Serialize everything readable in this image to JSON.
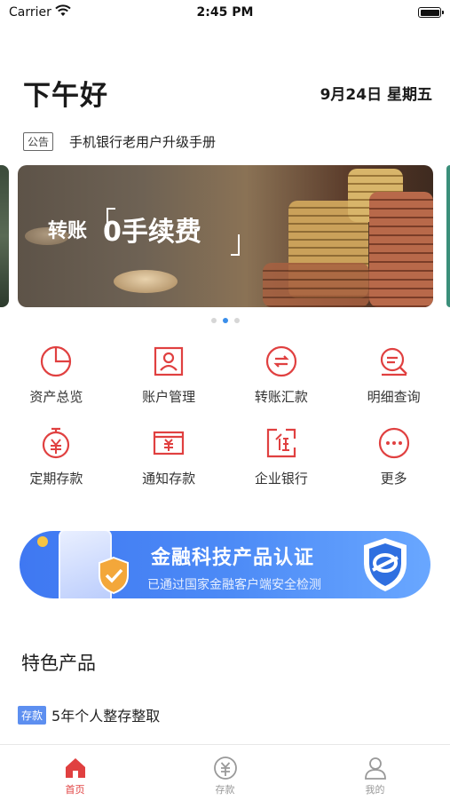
{
  "status_bar": {
    "carrier": "Carrier",
    "time": "2:45 PM"
  },
  "header": {
    "greeting": "下午好",
    "date": "9月24日 星期五"
  },
  "notice": {
    "tag": "公告",
    "text": "手机银行老用户升级手册"
  },
  "banner": {
    "text_prefix": "转账",
    "text_highlight": "0手续费",
    "page_count": 3,
    "active_page": 2
  },
  "quick_actions": [
    {
      "label": "资产总览",
      "icon": "pie-chart-icon"
    },
    {
      "label": "账户管理",
      "icon": "account-icon"
    },
    {
      "label": "转账汇款",
      "icon": "transfer-icon"
    },
    {
      "label": "明细查询",
      "icon": "search-detail-icon"
    },
    {
      "label": "定期存款",
      "icon": "timer-deposit-icon"
    },
    {
      "label": "通知存款",
      "icon": "notice-deposit-icon"
    },
    {
      "label": "企业银行",
      "icon": "enterprise-icon"
    },
    {
      "label": "更多",
      "icon": "more-icon"
    }
  ],
  "certification": {
    "title": "金融科技产品认证",
    "subtitle": "已通过国家金融客户端安全检测"
  },
  "featured": {
    "title": "特色产品",
    "tag": "存款",
    "product_name": "5年个人整存整取"
  },
  "tab_bar": {
    "items": [
      {
        "label": "首页",
        "icon": "home-icon",
        "active": true
      },
      {
        "label": "存款",
        "icon": "yuan-icon",
        "active": false
      },
      {
        "label": "我的",
        "icon": "user-icon",
        "active": false
      }
    ]
  },
  "colors": {
    "accent": "#e04040",
    "brand_blue": "#4c8af6",
    "dot_active": "#3a8eea"
  }
}
